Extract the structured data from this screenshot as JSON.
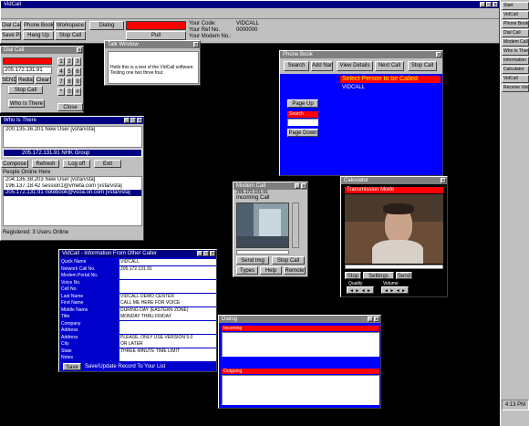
{
  "app": {
    "title": "VidCall",
    "menu_buttons": [
      "Dial Call",
      "Phone Book",
      "Workspace",
      "Dialog",
      "Save Prefs",
      "Hang Up",
      "Stop Call",
      "Pull"
    ],
    "status_labels": {
      "your_code": "Your Code:",
      "your_ref": "Your Ref No.",
      "your_modem": "Your Modem No.:"
    },
    "status_values": {
      "your_code": "VIDCALL",
      "your_ref": "0000000"
    }
  },
  "taskbar": {
    "items": [
      "Start",
      "VidCall",
      "Phone Book",
      "Dial Call",
      "Modem Call",
      "Who Is There",
      "Information",
      "Calculator",
      "VidCall",
      "Receive Voice"
    ],
    "clock": "4:13 PM"
  },
  "dial_window": {
    "title": "Dial Call",
    "number": "205.172.131.91",
    "keys": [
      "1",
      "2",
      "3",
      "4",
      "5",
      "6",
      "7",
      "8",
      "9",
      "*",
      "0",
      "#"
    ],
    "buttons": [
      "SEND",
      "Redial",
      "Clear",
      "Stop Call",
      "Who Is There"
    ]
  },
  "talk_window": {
    "title": "Talk Window",
    "text": "Hello this is a test of the VidCall software. Testing one two three four."
  },
  "who_window": {
    "title": "Who Is There",
    "list_top": [
      "200.135.36.201 New User [vsfa/vsfa]"
    ],
    "selected": "205.172.131.91 NHK Group",
    "buttons": [
      "Compose",
      "Refresh",
      "Log off",
      "Exit"
    ],
    "section_label": "People Online Here",
    "list": [
      "204.136.38.203 New User [vsfa/vsfa]",
      "196.137.18.42 session1@vmeta.com [vsfa/vsfa]",
      "205.172.131.91 notebook@vsoa.on.com [vsfa/vsfa]"
    ],
    "footer": "Registered: 3 Users Online"
  },
  "phone_book": {
    "title": "Phone Book",
    "buttons": [
      "Search",
      "Add Name",
      "View Details",
      "Next Call",
      "Stop Call"
    ],
    "banner": "Select Person to be Called",
    "entry": "VIDCALL",
    "side_buttons": [
      "Page Up",
      "Page Down"
    ],
    "side_field": "Search"
  },
  "modem_call": {
    "title": "Modem Call",
    "ip": "205.172.131.91",
    "status": "Incoming Call",
    "buttons": [
      "Send Img",
      "Stop Call",
      "Types",
      "Help",
      "Remote"
    ]
  },
  "calculator": {
    "title": "Calculator",
    "banner": "Transmission Mode",
    "buttons": [
      "Stop",
      "Settings",
      "Send"
    ],
    "slider_labels": [
      "Quality",
      "Volume"
    ]
  },
  "info_window": {
    "title": "VidCall - Information From Other Caller",
    "labels": [
      "Quick Name",
      "Network Call No.",
      "Modem Portal No.",
      "Voice No.",
      "Cell No.",
      "Last Name",
      "First Name",
      "Middle Name",
      "Title",
      "Company",
      "Address",
      "Address",
      "City",
      "State",
      "Notes"
    ],
    "values": [
      "VIDCALL",
      "205.172.131.91",
      "",
      "",
      "",
      "VIDCALL DEMO CENTER",
      "CALL ME HERE FOR VOICE",
      "DURING DAY (EASTERN ZONE)",
      "MONDAY THRU FRIDAY",
      "",
      "",
      "PLEASE, ONLY USE VERSION 5.0",
      "OR LATER",
      "THREE MINUTE TIME LIMIT",
      ""
    ],
    "save_button": "Save",
    "footer": "Save/Update Record To Your List"
  },
  "dialog_window": {
    "title": "Dialog",
    "panel1_label": "Incoming",
    "panel2_label": "Outgoing"
  }
}
